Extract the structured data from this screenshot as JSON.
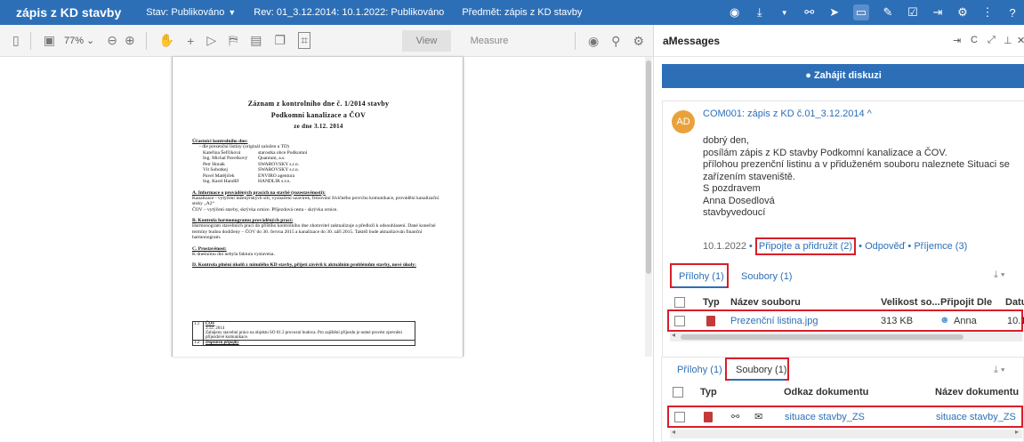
{
  "topbar": {
    "title": "zápis z KD stavby",
    "status": "Stav: Publikováno",
    "revision": "Rev: 01_3.12.2014: 10.1.2022: Publikováno",
    "subject": "Předmět: zápis z KD stavby",
    "icons": [
      "record-icon",
      "download-icon",
      "chevron-down-icon",
      "link-icon",
      "send-icon",
      "messages-icon",
      "attach-icon",
      "edit-icon",
      "share-icon",
      "settings-icon",
      "more-icon",
      "help-icon"
    ]
  },
  "toolbar": {
    "zoom": "77% ⌄",
    "view_label": "View",
    "measure_label": "Measure"
  },
  "document": {
    "heading1": "Záznam z kontrolního dne č. 1/2014 stavby",
    "heading2": "Podkomní kanalizace a ČOV",
    "heading3": "ze dne 3.12. 2014",
    "participants_title": "Účastníci kontrolního dne:",
    "participants_note": "- dle prezenční listiny (originál založen u TD)",
    "participants": [
      {
        "name": "Kateřina Šefčíková",
        "org": "starostka obce Podkomní"
      },
      {
        "name": "Ing. Michal Pavelkový",
        "org": "Quantum, a.s."
      },
      {
        "name": "Petr Honák",
        "org": "SWAROVSKY s.r.o."
      },
      {
        "name": "Vít Sobotkej",
        "org": "SWAROVSKY s.r.o."
      },
      {
        "name": "Pavel Matějíček",
        "org": "ENVIRO agentura"
      },
      {
        "name": "Ing. Karel Handlíř",
        "org": "HANDLIR s.r.o."
      }
    ],
    "sectionA_title": "A. Informace o prováděných pracích na stavbě (rozestavěnosti):",
    "sectionA_text1": "Kanalizace - vytýčení inženýrských sítí, vyznačení uzavírek, frézování živičného povrchu komunikace, provádění kanalizační stoky „A2“",
    "sectionA_text2": "ČOV – vytýčení stavby, skrývka ornice. Příjezdová cesta - skrývka ornice.",
    "sectionB_title": "B. Kontrola harmonogramu prováděných prací:",
    "sectionB_text": "Harmonogram stavebních prací do příštího kontrolního dne zhotovitel zaktualizuje a předloží k odsouhlasení. Dané konečné termíny budou dodrženy – ČOV do 30. června 2015 a kanalizace do 30. září 2015. Taktéž bude aktualizován finanční harmonogram.",
    "sectionC_title": "C. Prostavěnost:",
    "sectionC_text": "K dnešnímu dni nebyla faktura vystavena.",
    "sectionD_title": "D. Kontrola plnění úkolů z minulého KD stavby, přijetí závěrů k aktuálním problémům stavby, nové úkoly:",
    "table": [
      {
        "num": "1.1",
        "title": "ČOV",
        "lines": [
          "3.12. 2014",
          "Zahájeny stavební práce na objektu SO 01.3 provozní budova. Pro zajištění příjezdu je nutné provést zpevnění příjezdové komunikace."
        ]
      },
      {
        "num": "1.2",
        "title": "Dopravní přípojky",
        "lines": []
      }
    ]
  },
  "messages": {
    "header": "aMessages",
    "start_discussion": "Zahájit diskuzi",
    "comment": {
      "avatar": "AD",
      "title": "COM001: zápis z KD č.01_3.12.2014 ^",
      "lines": [
        "dobrý den,",
        "posílám zápis z KD stavby Podkomní kanalizace a ČOV.",
        "přílohou prezenční listinu a v přiduženém souboru naleznete Situaci se zařízením staveniště.",
        "S pozdravem",
        "Anna Dosedlová",
        "stavbyvedoucí"
      ],
      "date": "10.1.2022",
      "attach_link": "Připojte a přidružit (2)",
      "reply_link": "Odpověď",
      "recipients_link": "Příjemce (3)",
      "dot": "•"
    },
    "attachments_tab": "Přílohy (1)",
    "files_tab": "Soubory (1)",
    "att_headers": {
      "type": "Typ",
      "name": "Název souboru",
      "size": "Velikost so...",
      "attached_by": "Připojit Dle",
      "date": "Datu"
    },
    "att_row": {
      "name": "Prezenční listina.jpg",
      "size": "313 KB",
      "attached_by": "Anna",
      "date": "10.1"
    },
    "files_headers": {
      "type": "Typ",
      "link": "Odkaz dokumentu",
      "name": "Název dokumentu"
    },
    "files_row": {
      "link": "situace stavby_ZS",
      "name": "situace stavby_ZS"
    }
  },
  "colors": {
    "accent": "#2d6fb7",
    "highlight": "#d91e2a",
    "avatar": "#e9a23b"
  }
}
